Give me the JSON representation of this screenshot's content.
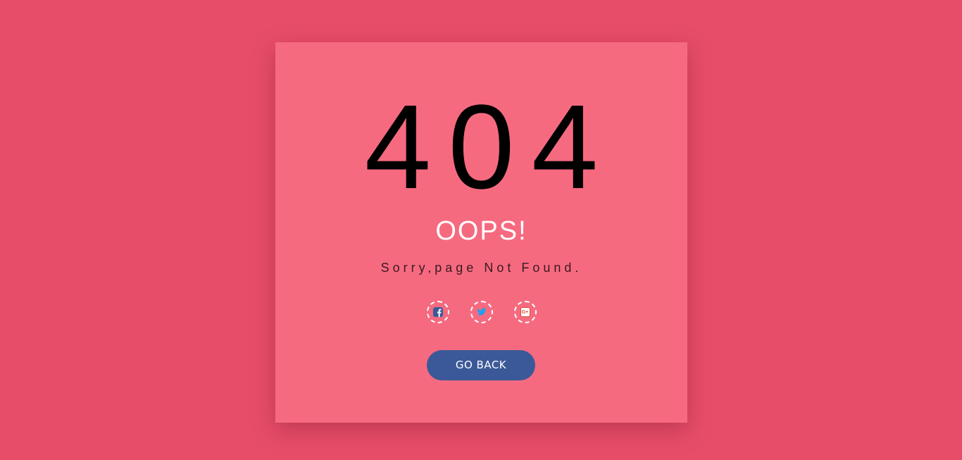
{
  "error": {
    "code": "404",
    "headline": "OOPS!",
    "message": "Sorry,page Not Found."
  },
  "social": [
    {
      "icon": "facebook-icon",
      "color": "#3b5998"
    },
    {
      "icon": "twitter-icon",
      "color": "#1da1f2"
    },
    {
      "icon": "google-plus-icon",
      "color": "#dd4b39",
      "glyph": "G+"
    }
  ],
  "actions": {
    "go_back_label": "GO BACK"
  },
  "colors": {
    "page_background": "#e74d68",
    "card_background": "#f66a80",
    "button_background": "#3b5998"
  }
}
